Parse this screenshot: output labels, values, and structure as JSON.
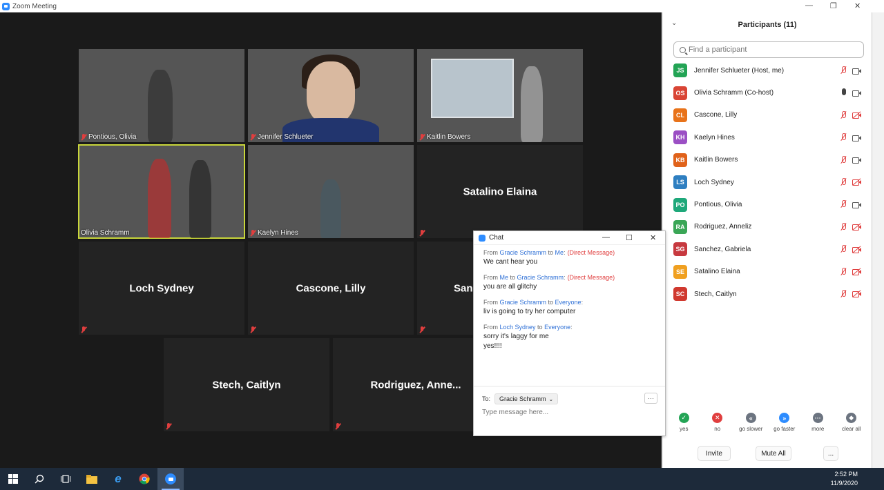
{
  "window": {
    "title": "Zoom Meeting",
    "controls": {
      "minimize": "—",
      "restore": "❐",
      "close": "✕"
    }
  },
  "gallery": [
    {
      "name": "Pontious, Olivia",
      "video": true,
      "style": "olivia-p",
      "center_name": ""
    },
    {
      "name": "Jennifer Schlueter",
      "video": true,
      "style": "jennifer",
      "center_name": ""
    },
    {
      "name": "Kaitlin Bowers",
      "video": true,
      "style": "kaitlin",
      "center_name": ""
    },
    {
      "name": "Olivia Schramm",
      "video": true,
      "style": "olivia-s",
      "center_name": "",
      "active": true
    },
    {
      "name": "Kaelyn Hines",
      "video": true,
      "style": "kaelyn",
      "center_name": ""
    },
    {
      "name": "",
      "video": false,
      "center_name": "Satalino Elaina"
    },
    {
      "name": "",
      "video": false,
      "center_name": "Loch Sydney"
    },
    {
      "name": "",
      "video": false,
      "center_name": "Cascone, Lilly"
    },
    {
      "name": "",
      "video": false,
      "center_name": "San"
    },
    {
      "name": "",
      "video": false,
      "center_name": "Stech, Caitlyn"
    },
    {
      "name": "",
      "video": false,
      "center_name": "Rodriguez,  Anne..."
    }
  ],
  "participants": {
    "collapse_icon": "chevron-down",
    "title": "Participants (11)",
    "search_placeholder": "Find a participant",
    "list": [
      {
        "initials": "JS",
        "color": "#23a455",
        "name": "Jennifer Schlueter (Host, me)",
        "mic": "muted",
        "cam": "on"
      },
      {
        "initials": "OS",
        "color": "#d94535",
        "name": "Olivia Schramm (Co-host)",
        "mic": "on",
        "cam": "on"
      },
      {
        "initials": "CL",
        "color": "#e8731a",
        "name": "Cascone, Lilly",
        "mic": "muted",
        "cam": "off"
      },
      {
        "initials": "KH",
        "color": "#9b4fc4",
        "name": "Kaelyn Hines",
        "mic": "muted",
        "cam": "on"
      },
      {
        "initials": "KB",
        "color": "#e0621a",
        "name": "Kaitlin Bowers",
        "mic": "muted",
        "cam": "on"
      },
      {
        "initials": "LS",
        "color": "#2f7fc1",
        "name": "Loch Sydney",
        "mic": "muted",
        "cam": "off"
      },
      {
        "initials": "PO",
        "color": "#1ea87a",
        "name": "Pontious, Olivia",
        "mic": "muted",
        "cam": "on"
      },
      {
        "initials": "RA",
        "color": "#3aa656",
        "name": "Rodriguez, Anneliz",
        "mic": "muted",
        "cam": "off"
      },
      {
        "initials": "SG",
        "color": "#c7393f",
        "name": "Sanchez, Gabriela",
        "mic": "muted",
        "cam": "off"
      },
      {
        "initials": "SE",
        "color": "#f0a020",
        "name": "Satalino Elaina",
        "mic": "muted",
        "cam": "off"
      },
      {
        "initials": "SC",
        "color": "#d0392f",
        "name": "Stech, Caitlyn",
        "mic": "muted",
        "cam": "off"
      }
    ],
    "feedback": [
      {
        "label": "yes",
        "glyph": "✓",
        "color": "#23a455"
      },
      {
        "label": "no",
        "glyph": "✕",
        "color": "#e03e3e"
      },
      {
        "label": "go slower",
        "glyph": "«",
        "color": "#6c7480"
      },
      {
        "label": "go faster",
        "glyph": "»",
        "color": "#2d8cff"
      },
      {
        "label": "more",
        "glyph": "···",
        "color": "#6c7480"
      },
      {
        "label": "clear all",
        "glyph": "◆",
        "color": "#6c7480"
      }
    ],
    "invite": "Invite",
    "mute_all": "Mute All",
    "more": "..."
  },
  "chat": {
    "title": "Chat",
    "controls": {
      "minimize": "—",
      "maximize": "☐",
      "close": "✕"
    },
    "messages": [
      {
        "from": "Gracie Schramm",
        "to": "Me",
        "direct": "(Direct Message)",
        "lines": [
          "We cant hear you"
        ]
      },
      {
        "from": "Me",
        "to": "Gracie Schramm",
        "direct": "(Direct Message)",
        "lines": [
          "you are all glitchy"
        ]
      },
      {
        "from": "Gracie Schramm",
        "to": "Everyone",
        "direct": "",
        "lines": [
          "liv is going to try her computer"
        ]
      },
      {
        "from": "Loch Sydney",
        "to": "Everyone",
        "direct": "",
        "lines": [
          "sorry it's laggy for me",
          "yes!!!!"
        ]
      }
    ],
    "to_label": "To:",
    "to_value": "Gracie Schramm",
    "more": "···",
    "input_placeholder": "Type message here..."
  },
  "taskbar": {
    "time": "2:52 PM",
    "date": "11/9/2020"
  }
}
